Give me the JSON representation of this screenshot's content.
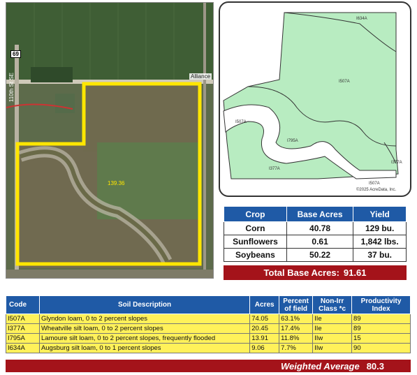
{
  "aerial": {
    "road_marker": "69",
    "road_label": "110th St SE",
    "town_label": "Alliance",
    "field_acres_label": "139.36"
  },
  "soil_map": {
    "units": [
      "I634A",
      "I507A",
      "I507A",
      "I795A",
      "I377A",
      "I377A",
      "I507A"
    ],
    "copyright": "©2025 AcreData, Inc."
  },
  "crop_table": {
    "headers": [
      "Crop",
      "Base Acres",
      "Yield"
    ],
    "rows": [
      {
        "crop": "Corn",
        "base": "40.78",
        "yield": "129 bu."
      },
      {
        "crop": "Sunflowers",
        "base": "0.61",
        "yield": "1,842 lbs."
      },
      {
        "crop": "Soybeans",
        "base": "50.22",
        "yield": "37 bu."
      }
    ],
    "total_label": "Total Base Acres:",
    "total_value": "91.61"
  },
  "soil_table": {
    "headers": {
      "code": "Code",
      "desc": "Soil Description",
      "acres": "Acres",
      "pct": "Percent of field",
      "class": "Non-Irr Class *c",
      "pi": "Productivity Index"
    },
    "rows": [
      {
        "code": "I507A",
        "desc": "Glyndon loam, 0 to 2 percent slopes",
        "acres": "74.05",
        "pct": "63.1%",
        "class": "IIe",
        "pi": "89"
      },
      {
        "code": "I377A",
        "desc": "Wheatville silt loam, 0 to 2 percent slopes",
        "acres": "20.45",
        "pct": "17.4%",
        "class": "IIe",
        "pi": "89"
      },
      {
        "code": "I795A",
        "desc": "Lamoure silt loam, 0 to 2 percent slopes, frequently flooded",
        "acres": "13.91",
        "pct": "11.8%",
        "class": "IIw",
        "pi": "15"
      },
      {
        "code": "I634A",
        "desc": "Augsburg silt loam, 0 to 1 percent slopes",
        "acres": "9.06",
        "pct": "7.7%",
        "class": "IIw",
        "pi": "90"
      }
    ],
    "avg_label": "Weighted Average",
    "avg_value": "80.3"
  },
  "colors": {
    "header_blue": "#1f5aa6",
    "total_red": "#a4131a",
    "row_yellow": "#fff15a",
    "boundary_yellow": "#ffe600",
    "soil_green": "#b8ecc1"
  }
}
